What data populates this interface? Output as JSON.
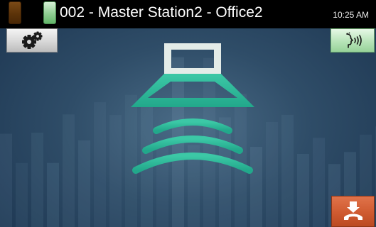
{
  "status_bar": {
    "title": "002 - Master Station2 - Office2",
    "time": "10:25 AM",
    "indicators": [
      {
        "name": "line-indicator-1",
        "color": "#6b3e10"
      },
      {
        "name": "line-indicator-2",
        "color": "#8fce92"
      }
    ]
  },
  "buttons": {
    "settings": {
      "icon": "gears-icon"
    },
    "talk": {
      "icon": "speaking-head-icon",
      "color": "#b7e4b8"
    },
    "hangup": {
      "icon": "hang-up-phone-icon",
      "color": "#cf5a30"
    }
  },
  "main": {
    "icon": "speaker-sound-waves-icon",
    "accent_color": "#2fb89a"
  }
}
